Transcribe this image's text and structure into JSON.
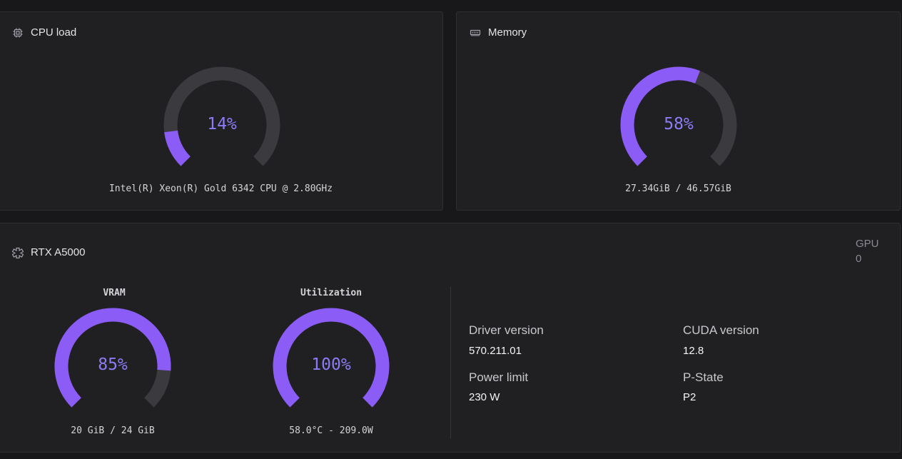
{
  "colors": {
    "accent": "#8b5cf6",
    "track": "#3a3a3f",
    "value_text": "#8b7cf6"
  },
  "cpu": {
    "title": "CPU load",
    "icon": "cpu-chip-icon",
    "percent": 14,
    "percent_label": "14%",
    "caption": "Intel(R) Xeon(R) Gold 6342 CPU @ 2.80GHz"
  },
  "memory": {
    "title": "Memory",
    "icon": "memory-module-icon",
    "percent": 58,
    "percent_label": "58%",
    "caption": "27.34GiB / 46.57GiB"
  },
  "gpu": {
    "title": "RTX A5000",
    "icon": "gpu-icon",
    "index_label": "GPU",
    "index_value": "0",
    "vram": {
      "label": "VRAM",
      "percent": 85,
      "percent_label": "85%",
      "caption": "20 GiB / 24 GiB"
    },
    "utilization": {
      "label": "Utilization",
      "percent": 100,
      "percent_label": "100%",
      "caption": "58.0°C - 209.0W"
    },
    "info": {
      "driver_label": "Driver version",
      "driver_value": "570.211.01",
      "cuda_label": "CUDA version",
      "cuda_value": "12.8",
      "power_label": "Power limit",
      "power_value": "230 W",
      "pstate_label": "P-State",
      "pstate_value": "P2"
    }
  }
}
